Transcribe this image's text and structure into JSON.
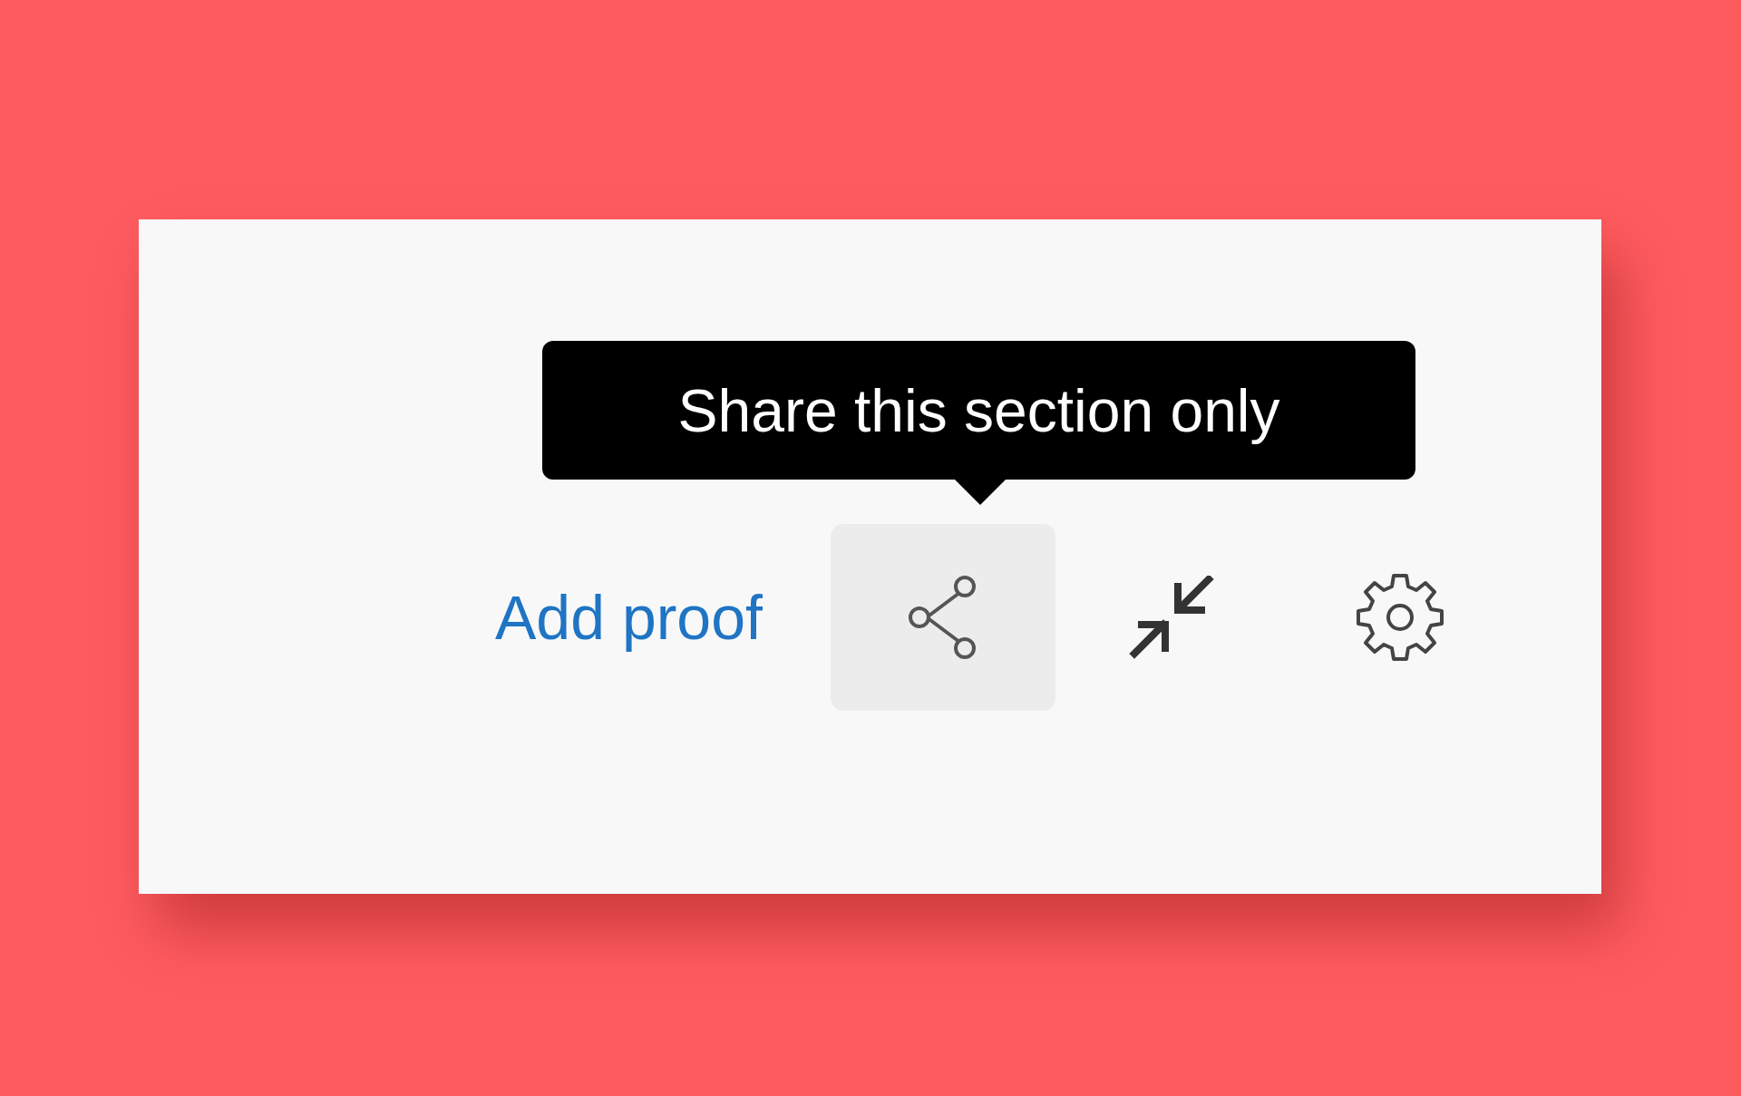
{
  "tooltip": {
    "text": "Share this section only"
  },
  "toolbar": {
    "link": "Add proof",
    "buttons": [
      {
        "kind": "share",
        "highlighted": true
      },
      {
        "kind": "collapse",
        "highlighted": false
      },
      {
        "kind": "settings",
        "highlighted": false
      }
    ]
  }
}
